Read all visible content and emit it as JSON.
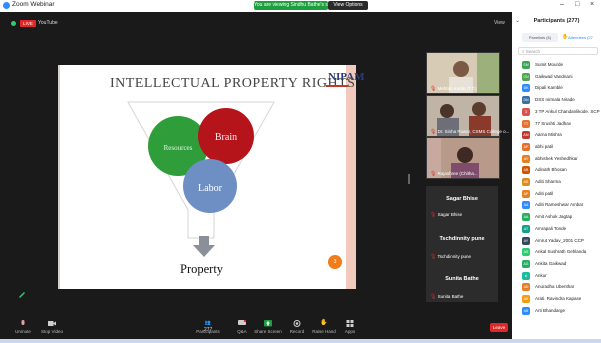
{
  "window": {
    "title": "Zoom Webinar",
    "share_banner": "You are viewing Sindhu Bathe's screen",
    "view_options": "View Options"
  },
  "meeting": {
    "live_badge": "LIVE",
    "live_label": "YouTube",
    "view_label": "View"
  },
  "slide": {
    "title": "INTELLECTUAL PROPERTY RIGHTS",
    "logo_text": "NIPAM",
    "circles": [
      "Resources",
      "Brain",
      "Labor"
    ],
    "result": "Property",
    "page": "3",
    "colors": {
      "resources": "#2f9e3a",
      "brain": "#b5141b",
      "labor": "#6d8fc4",
      "arrow": "#8a8f99"
    }
  },
  "videos": [
    {
      "name": "Mehtab Kettle (T.T.)"
    },
    {
      "name": "Dr. Sinha Pawar, CSMS College o..."
    },
    {
      "name": "Rajashree (Chitha..."
    }
  ],
  "name_tiles": [
    {
      "tile": "Sagar Bhise",
      "label": "Sagar Bhise"
    },
    {
      "tile": "Tschdinnity pune",
      "label": "Tschdinnity pune"
    },
    {
      "tile": "Sunita Bathe",
      "label": "Sunita Bathe"
    }
  ],
  "participants": {
    "header": "Participants (277)",
    "tab_a": "Panelists (6)",
    "tab_b": "Attendees (27",
    "search_placeholder": "Search",
    "list": [
      {
        "initials": "SM",
        "name": "Sumit Mourde",
        "color": "#3aa655"
      },
      {
        "initials": "GN",
        "name": "Gaikwad Vandnani",
        "color": "#4fa64f"
      },
      {
        "initials": "DK",
        "name": "Dipali Kamble",
        "color": "#2d8cff"
      },
      {
        "initials": "DN",
        "name": "DSS nirmala Nirade",
        "color": "#3a6ea5"
      },
      {
        "initials": "3",
        "name": "3 TP Ankul Chandanlikode. SCP",
        "color": "#d9534f"
      },
      {
        "initials": "TT",
        "name": "77 Srushti Jadhav",
        "color": "#e8702a"
      },
      {
        "initials": "AM",
        "name": "Aarna Mishra",
        "color": "#c0392b"
      },
      {
        "initials": "AP",
        "name": "abhi patil",
        "color": "#e8702a"
      },
      {
        "initials": "AY",
        "name": "abhishek Yeshedhkar",
        "color": "#e67e22"
      },
      {
        "initials": "AB",
        "name": "Adinath Bhosan",
        "color": "#d35400"
      },
      {
        "initials": "AS",
        "name": "Aditi Sharma",
        "color": "#e08a1e"
      },
      {
        "initials": "AP",
        "name": "Aditi patil",
        "color": "#e67e22"
      },
      {
        "initials": "AA",
        "name": "Aditi Rameshwar Ambar",
        "color": "#2d8cff"
      },
      {
        "initials": "AA",
        "name": "Amit Ashok Jagtap",
        "color": "#27ae60"
      },
      {
        "initials": "AT",
        "name": "Amrapali Tonde",
        "color": "#16a085"
      },
      {
        "initials": "AY",
        "name": "Amrut Yadav_2001 CCP",
        "color": "#34495e"
      },
      {
        "initials": "AS",
        "name": "Ankal Sushrath Gehlanda",
        "color": "#2ecc71"
      },
      {
        "initials": "AG",
        "name": "Ankita Gaikwad",
        "color": "#27ae60"
      },
      {
        "initials": "A",
        "name": "Ankur",
        "color": "#1abc9c"
      },
      {
        "initials": "AD",
        "name": "Anuradha Ubenthar",
        "color": "#e67e22"
      },
      {
        "initials": "AK",
        "name": "Arati. Ravindra Kapase",
        "color": "#f39c12"
      },
      {
        "initials": "AB",
        "name": "Arti Bhandarge",
        "color": "#2d8cff"
      }
    ]
  },
  "toolbar": {
    "unmute": "Unmute",
    "stop_video": "Stop Video",
    "participants": "Participants",
    "participants_count": "277",
    "qa": "Q&A",
    "share_screen": "Share Screen",
    "record": "Record",
    "raise_hand": "Raise Hand",
    "apps": "Apps",
    "end": "Leave"
  }
}
